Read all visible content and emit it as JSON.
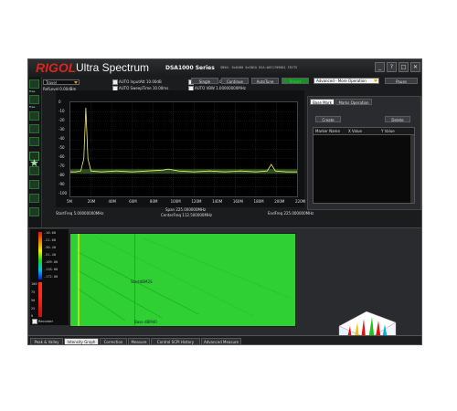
{
  "app": {
    "brand": "RIGOL",
    "product": "Ultra Spectrum",
    "series": "DSA1000 Series",
    "device_info": "SN50: Ds0400  0x5BCA  DSA:bDC1709001  IRITS",
    "window_buttons": [
      "_",
      "?",
      "□",
      "✕"
    ]
  },
  "left_toolbar": {
    "labels": [
      "Free",
      "Free"
    ]
  },
  "toolbar": {
    "mode_dropdown": "Travel",
    "ref_level": "RefLevel   0.00dBm",
    "auto_inputatt": "AUTO InputAtt   10.00dB",
    "auto_sweeptime": "AUTO SweepTime  10.00ms",
    "auto_rbw": "AUTO RBW    1.00000000MHz",
    "auto_vbw": "AUTO VBW    1.00000000MHz",
    "single": "Single",
    "continue": "Continue",
    "autotune": "AutoTune",
    "green_button": "Preset",
    "advanced_dropdown": "Advanced - More Operation",
    "pause": "Pause"
  },
  "spectrum": {
    "y_ticks": [
      "0",
      "-10",
      "-20",
      "-30",
      "-40",
      "-50",
      "-60",
      "-70",
      "-80",
      "-90",
      "-100"
    ],
    "x_ticks": [
      "5M",
      "20M",
      "40M",
      "60M",
      "80M",
      "100M",
      "120M",
      "140M",
      "160M",
      "180M",
      "200M",
      "220M"
    ],
    "start_freq": "StartFreq   5.00000000MHz",
    "span": "Span  225.000000MHz",
    "center_freq": "CenterFreq  112.500000MHz",
    "end_freq": "EndFreq  225.000000MHz"
  },
  "chart_data": {
    "type": "line",
    "title": "",
    "xlabel": "",
    "ylabel": "",
    "xlim": [
      5,
      225
    ],
    "ylim": [
      -100,
      0
    ],
    "x": [
      5,
      10,
      15,
      18,
      20,
      22,
      25,
      35,
      50,
      65,
      80,
      95,
      100,
      110,
      125,
      140,
      155,
      170,
      185,
      196,
      200,
      204,
      215,
      225
    ],
    "series": [
      {
        "values": [
          -74,
          -74,
          -73,
          -60,
          -6,
          -60,
          -73,
          -74,
          -73,
          -74,
          -73,
          -72,
          -71,
          -73,
          -74,
          -73,
          -74,
          -73,
          -74,
          -73,
          -66,
          -73,
          -74,
          -74
        ]
      }
    ]
  },
  "right_panel": {
    "tabs": [
      "Base Mark",
      "Marks Operation"
    ],
    "create": "Create",
    "delete": "Delete",
    "columns": [
      "Marker Name",
      "X Value",
      "Y Value"
    ]
  },
  "intensity": {
    "y_labels": [
      "-10.00",
      "-21.00",
      "-30.40",
      "-51.40",
      "-109.00",
      "-116.00",
      "-172.00"
    ],
    "scale_labels": [
      "100",
      "75",
      "50",
      "25",
      "0"
    ],
    "center_label": "StartdBM2S",
    "bottom_label": "Base dBM40",
    "record_label": "Recorder"
  },
  "bottom_tabs": [
    "Peak & Valley",
    "Intensity Graph",
    "Correction",
    "Measure",
    "Control SCPI History",
    "Advanced Measure"
  ]
}
